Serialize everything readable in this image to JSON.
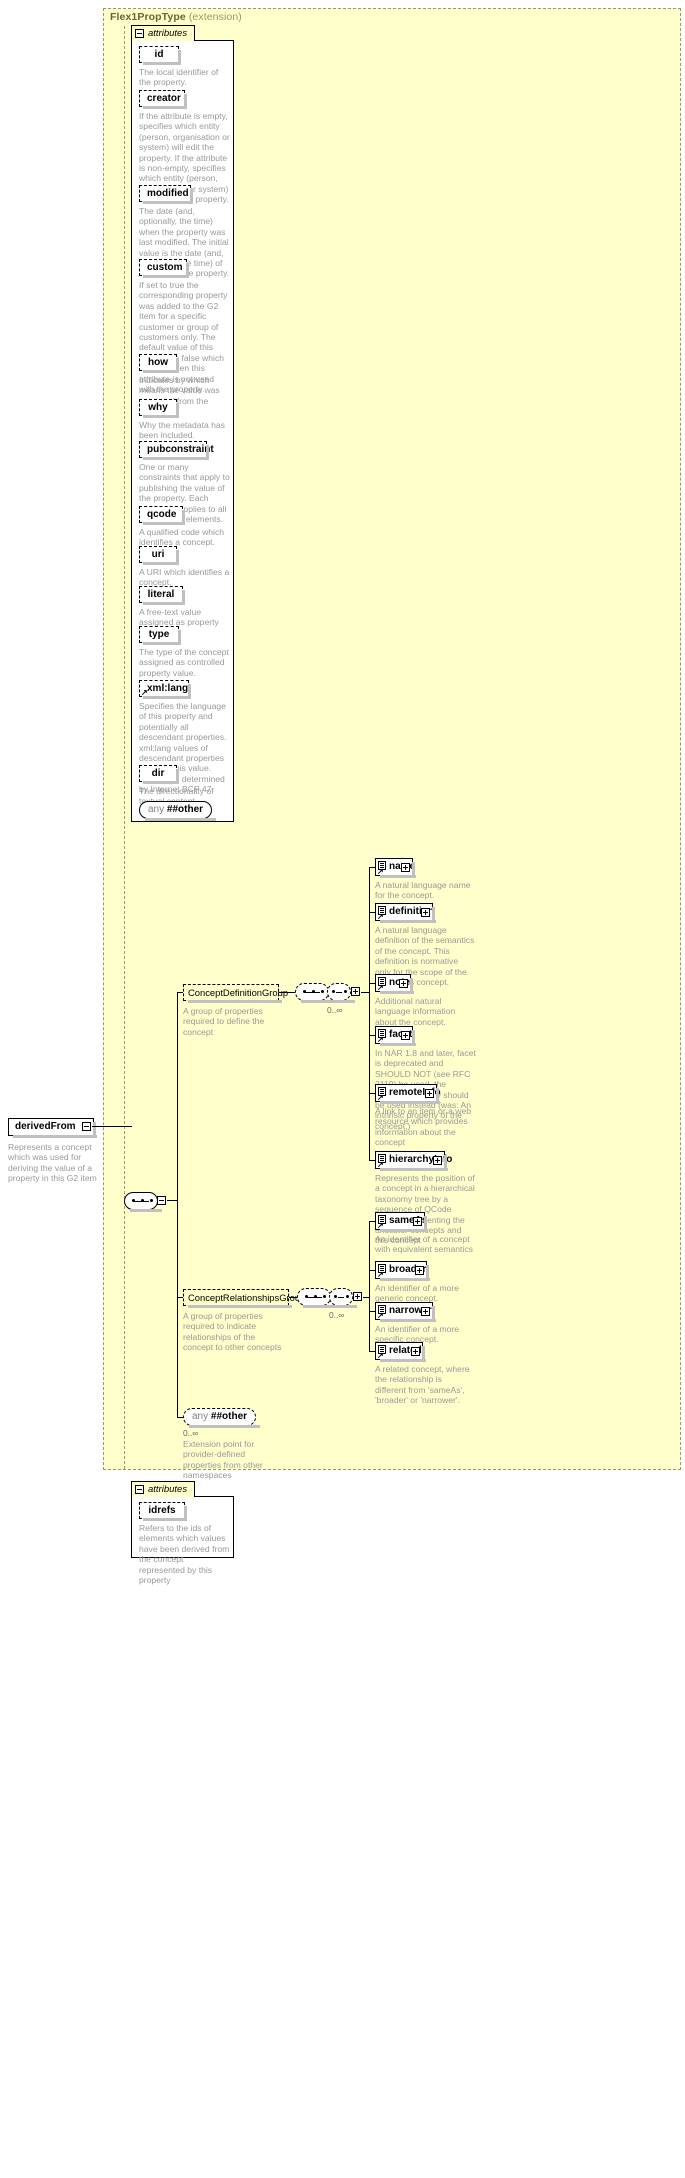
{
  "diagram": {
    "type": "xsd-schema-diagram",
    "root_element": {
      "name": "derivedFrom",
      "doc": "Represents a concept which was used for deriving the value of a property in this G2 item",
      "toggle": "minus"
    },
    "extension": {
      "title": "Flex1PropType",
      "subtitle": "(extension)"
    },
    "attributes_section_label": "attributes",
    "attributes": [
      {
        "name": "id",
        "doc": "The local identifier of the property."
      },
      {
        "name": "creator",
        "doc": "If the attribute is empty, specifies which entity (person, organisation or system) will edit the property. If the attribute is non-empty, specifies which entity (person, organisation or system) has edited the property."
      },
      {
        "name": "modified",
        "doc": "The date (and, optionally, the time) when the property was last modified. The initial value is the date (and, optionally, the time) of creation of the property."
      },
      {
        "name": "custom",
        "doc": "If set to true the corresponding property was added to the G2 Item for a specific customer or group of customers only. The default value of this property is false which applies when this attribute is not used with the property."
      },
      {
        "name": "how",
        "doc": "Indicates by which means the value was extracted from the content."
      },
      {
        "name": "why",
        "doc": "Why the metadata has been included."
      },
      {
        "name": "pubconstraint",
        "doc": "One or many constraints that apply to publishing the value of the property. Each constraint applies to all descendant elements."
      },
      {
        "name": "qcode",
        "doc": "A qualified code which identifies a concept."
      },
      {
        "name": "uri",
        "doc": "A URI which identifies a concept."
      },
      {
        "name": "literal",
        "doc": "A free-text value assigned as property value."
      },
      {
        "name": "type",
        "doc": "The type of the concept assigned as controlled property value."
      },
      {
        "name": "xmllang",
        "label": "xml:lang",
        "doc": "Specifies the language of this property and potentially all descendant properties. xml:lang values of descendant properties override this value. Values are determined by Internet BCP 47."
      },
      {
        "name": "dir",
        "doc": "The directionality of textual content."
      }
    ],
    "attributes_any": {
      "prefix": "any",
      "namespace": "##other"
    },
    "groups": [
      {
        "name": "ConceptDefinitionGroup",
        "doc": "A group of properties required to define the concept",
        "cardinality": "0..∞",
        "children": [
          {
            "name": "name",
            "doc": "A natural language name for the concept."
          },
          {
            "name": "definition",
            "doc": "A natural language definition of the semantics of the concept. This definition is normative only for the scope of the use of this concept."
          },
          {
            "name": "note",
            "doc": "Additional natural language information about the concept."
          },
          {
            "name": "facet",
            "doc": "In NAR 1.8 and later, facet is deprecated and SHOULD NOT (see RFC 2119) be used. the “related” property should be used instead (was: An intrinsic property of the concept.)"
          },
          {
            "name": "remoteInfo",
            "doc": "A link to an item or a web resource which provides information about the concept"
          },
          {
            "name": "hierarchyInfo",
            "doc": "Represents the position of a concept in a hierarchical taxonomy tree by a sequence of QCode tokens representing the ancestor concepts and this concept"
          }
        ]
      },
      {
        "name": "ConceptRelationshipsGroup",
        "doc": "A group of properties required to indicate relationships of the concept to other concepts",
        "cardinality": "0..∞",
        "children": [
          {
            "name": "sameAs",
            "doc": "An identifier of a concept with equivalent semantics"
          },
          {
            "name": "broader",
            "doc": "An identifier of a more generic concept."
          },
          {
            "name": "narrower",
            "doc": "An identifier of a more specific concept."
          },
          {
            "name": "related",
            "doc": "A related concept, where the relationship is different from 'sameAs', 'broader' or 'narrower'."
          }
        ]
      }
    ],
    "content_any": {
      "prefix": "any",
      "namespace": "##other",
      "cardinality": "0..∞",
      "doc": "Extension point for provider-defined properties from other namespaces"
    },
    "bottom_attributes_section": {
      "label": "attributes",
      "attributes": [
        {
          "name": "idrefs",
          "doc": "Refers to the ids of elements which values have been derived from the concept represented by this property"
        }
      ]
    },
    "colors": {
      "panel_bg": "#ffffcc",
      "box_bg": "#ffffff",
      "doc_text": "#999999",
      "line": "#000000",
      "shadow": "#c0c0c0",
      "title_text": "#666633"
    }
  }
}
